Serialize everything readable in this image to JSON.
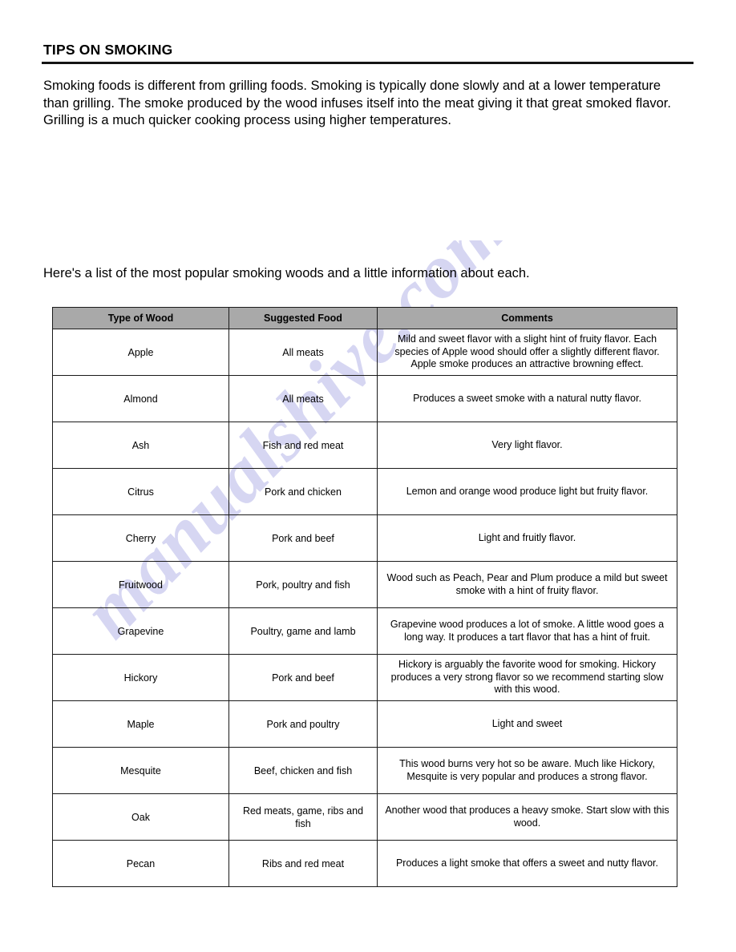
{
  "document": {
    "title": "TIPS ON SMOKING",
    "intro_paragraph": "Smoking foods is different from grilling foods.  Smoking is typically done slowly and at a lower temperature than grilling. The smoke produced by the wood infuses itself into the meat giving it that great smoked flavor.  Grilling is a much quicker cooking process using higher temperatures.",
    "lead_in": "Here's a list of the most popular smoking woods and a little information about each.",
    "watermark": "manualshive.com"
  },
  "colors": {
    "header_fill": "#a9a9a9",
    "rule": "#141414",
    "border": "#1a1a1a",
    "watermark": "#c9c9ee"
  },
  "table": {
    "headers": {
      "wood": "Type of Wood",
      "food": "Suggested Food",
      "comments": "Comments"
    },
    "rows": [
      {
        "wood": "Apple",
        "food": "All meats",
        "comments": "Mild and sweet flavor with a slight hint of fruity flavor.  Each species of Apple wood should offer a slightly different flavor.  Apple smoke produces an attractive browning effect."
      },
      {
        "wood": "Almond",
        "food": "All meats",
        "comments": "Produces a sweet smoke with a natural nutty flavor."
      },
      {
        "wood": "Ash",
        "food": "Fish and red meat",
        "comments": "Very light flavor."
      },
      {
        "wood": "Citrus",
        "food": "Pork and chicken",
        "comments": "Lemon and orange wood produce light but fruity flavor."
      },
      {
        "wood": "Cherry",
        "food": "Pork and beef",
        "comments": "Light and fruitly flavor."
      },
      {
        "wood": "Fruitwood",
        "food": "Pork, poultry and fish",
        "comments": "Wood such as Peach, Pear and Plum produce a mild but sweet smoke with a hint of fruity flavor."
      },
      {
        "wood": "Grapevine",
        "food": "Poultry, game and lamb",
        "comments": "Grapevine wood produces a lot of smoke.  A little wood goes a long way.  It produces a tart flavor that has a hint of fruit."
      },
      {
        "wood": "Hickory",
        "food": "Pork and beef",
        "comments": "Hickory is arguably the favorite wood for smoking.  Hickory produces a very strong flavor so we recommend starting slow with this wood."
      },
      {
        "wood": "Maple",
        "food": "Pork and poultry",
        "comments": "Light and sweet"
      },
      {
        "wood": "Mesquite",
        "food": "Beef, chicken and fish",
        "comments": "This wood burns very hot so be aware.  Much like Hickory, Mesquite is very popular and produces a strong flavor."
      },
      {
        "wood": "Oak",
        "food": "Red meats, game, ribs and fish",
        "comments": "Another wood that produces a heavy smoke.  Start slow with this wood."
      },
      {
        "wood": "Pecan",
        "food": "Ribs and red meat",
        "comments": "Produces a light smoke that offers a sweet and nutty flavor."
      }
    ]
  }
}
